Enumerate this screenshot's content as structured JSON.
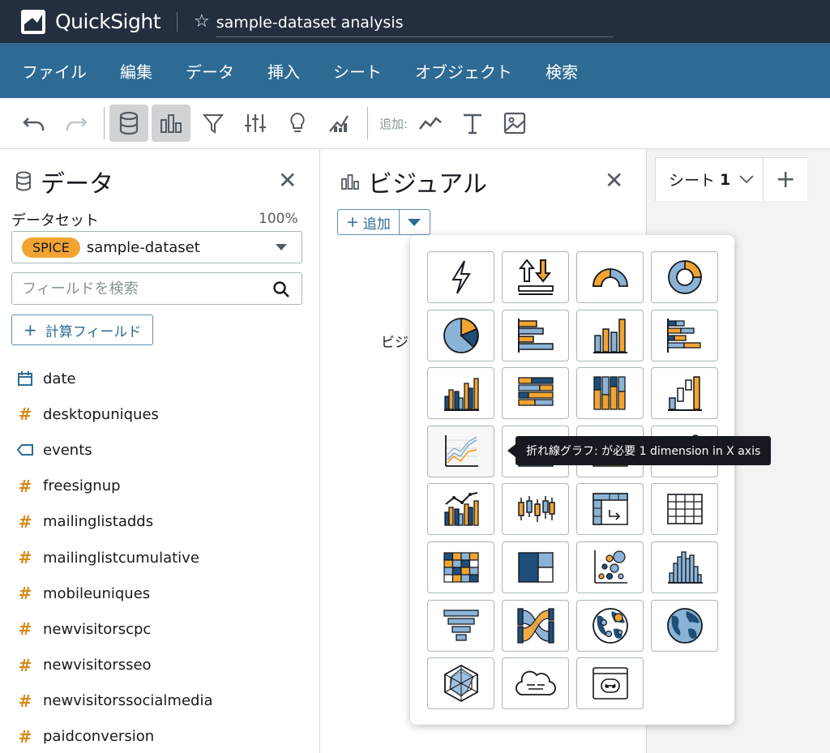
{
  "app": {
    "logo_text": "QuickSight",
    "analysis_title": "sample-dataset analysis"
  },
  "menu": {
    "items": [
      {
        "id": "file",
        "label": "ファイル"
      },
      {
        "id": "edit",
        "label": "編集"
      },
      {
        "id": "data",
        "label": "データ"
      },
      {
        "id": "insert",
        "label": "挿入"
      },
      {
        "id": "sheet",
        "label": "シート"
      },
      {
        "id": "object",
        "label": "オブジェクト"
      },
      {
        "id": "search",
        "label": "検索"
      }
    ]
  },
  "toolbar": {
    "add_label": "追加:",
    "buttons": [
      "undo-icon",
      "redo-icon",
      "database-icon",
      "bar-chart-icon",
      "filter-icon",
      "sliders-icon",
      "lightbulb-icon",
      "forecast-icon",
      "line-chart-icon",
      "text-icon",
      "image-icon"
    ]
  },
  "data_panel": {
    "title": "データ",
    "dataset_label": "データセット",
    "dataset_percent": "100%",
    "spice_badge": "SPICE",
    "dataset_name": "sample-dataset",
    "search_placeholder": "フィールドを検索",
    "calc_field_label": "計算フィールド",
    "fields": [
      {
        "name": "date",
        "type": "date"
      },
      {
        "name": "desktopuniques",
        "type": "number"
      },
      {
        "name": "events",
        "type": "string"
      },
      {
        "name": "freesignup",
        "type": "number"
      },
      {
        "name": "mailinglistadds",
        "type": "number"
      },
      {
        "name": "mailinglistcumulative",
        "type": "number"
      },
      {
        "name": "mobileuniques",
        "type": "number"
      },
      {
        "name": "newvisitorscpc",
        "type": "number"
      },
      {
        "name": "newvisitorsseo",
        "type": "number"
      },
      {
        "name": "newvisitorssocialmedia",
        "type": "number"
      },
      {
        "name": "paidconversion",
        "type": "number"
      }
    ]
  },
  "visual_panel": {
    "title": "ビジュアル",
    "add_label": "追加",
    "hidden_text": "ビジ"
  },
  "sheets": {
    "tab_label": "シート",
    "tab_number": "1"
  },
  "visual_types": [
    "autograph-icon",
    "kpi-icon",
    "gauge-chart-icon",
    "donut-chart-icon",
    "pie-chart-icon",
    "horizontal-bar-chart-icon",
    "vertical-bar-chart-icon",
    "horizontal-stacked-bar-chart-icon",
    "clustered-bar-combo-icon",
    "horizontal-stacked-100-bar-icon",
    "vertical-stacked-100-bar-icon",
    "waterfall-chart-icon",
    "line-chart-icon",
    "area-line-chart-icon",
    "stacked-area-chart-icon",
    "scatter-plot-icon",
    "line-bar-combo-icon",
    "box-plot-icon",
    "pivot-table-icon",
    "table-icon",
    "heat-map-icon",
    "tree-map-icon",
    "bubble-chart-icon",
    "histogram-icon",
    "funnel-chart-icon",
    "sankey-diagram-icon",
    "points-on-map-icon",
    "filled-map-icon",
    "radar-chart-icon",
    "word-cloud-icon",
    "custom-visual-icon"
  ],
  "tooltip": {
    "text": "折れ線グラフ: が必要 1 dimension in X axis"
  },
  "colors": {
    "topbar": "#232f3e",
    "menubar": "#2e6b94",
    "accent_orange": "#f2a431",
    "accent_blue": "#2e6b94",
    "chart_blue": "#1f4e79",
    "chart_light_blue": "#8bb3d6"
  }
}
